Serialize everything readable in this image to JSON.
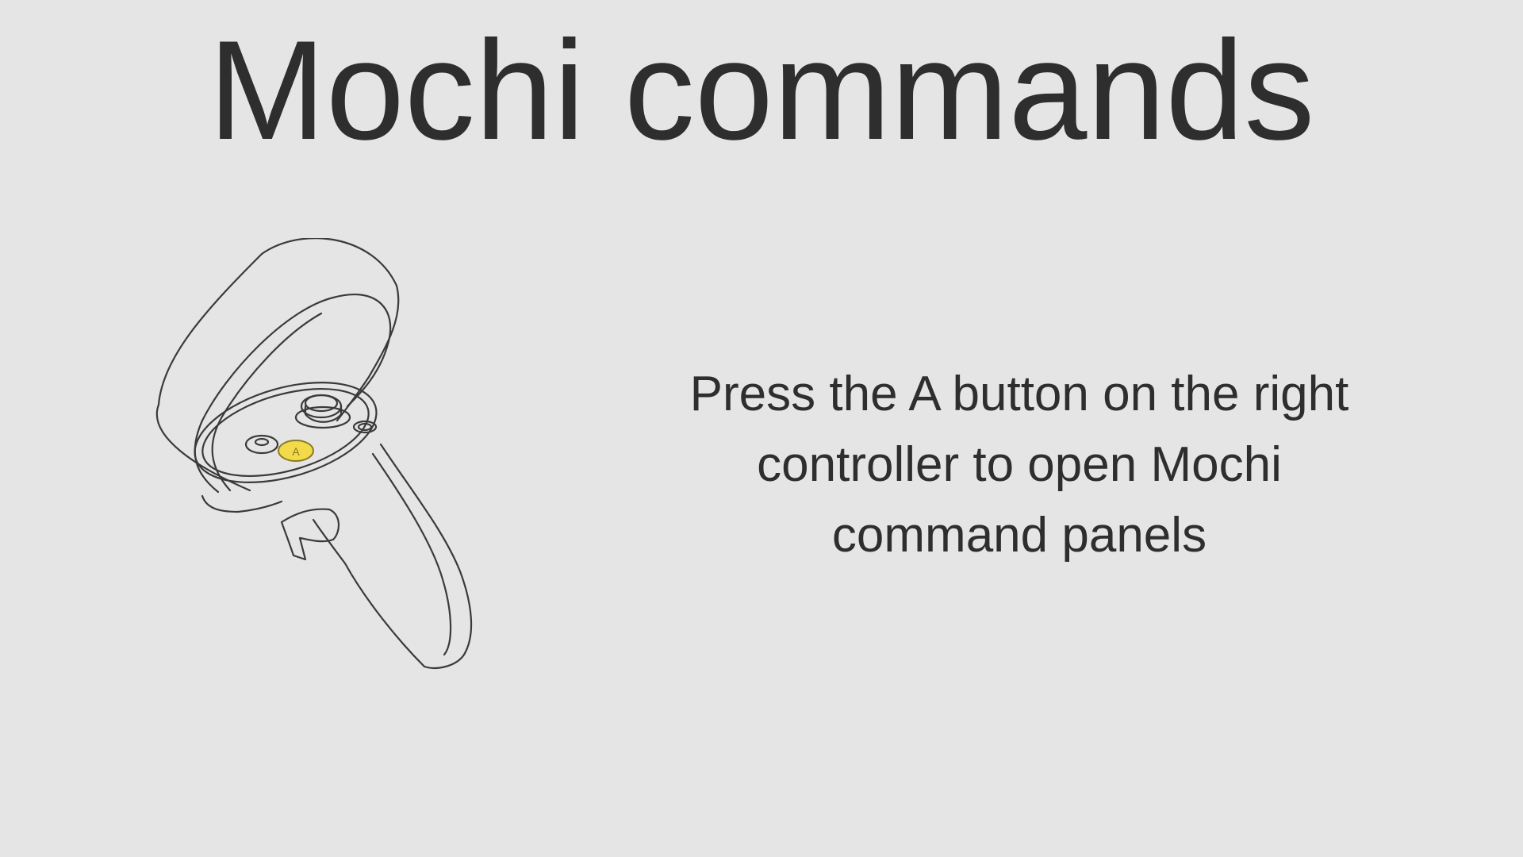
{
  "slide": {
    "title": "Mochi commands",
    "instruction": "Press the A button on the right controller to open Mochi command panels"
  },
  "illustration": {
    "icon": "vr-controller-icon",
    "button_label": "A",
    "highlight_color": "#f2da4a",
    "line_color": "#3a3a3a"
  },
  "colors": {
    "background": "#e5e5e5",
    "text": "#2e2e2e"
  }
}
